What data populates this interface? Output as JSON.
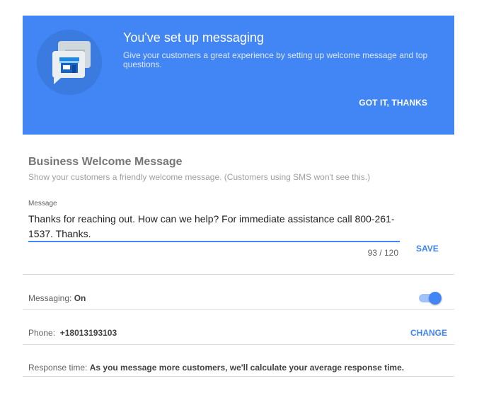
{
  "banner": {
    "title": "You've set up messaging",
    "description": "Give your customers a great experience by setting up welcome message and top questions.",
    "action_label": "GOT IT, THANKS",
    "background_color": "#4285f4",
    "icon": "storefront-chat-icon"
  },
  "welcome": {
    "title": "Business Welcome Message",
    "subtitle": "Show your customers a friendly welcome message. (Customers using SMS won't see this.)",
    "field_label": "Message",
    "message_value": "Thanks for reaching out. How can we help? For immediate assistance call 800-261-1537. Thanks.",
    "char_count": "93 / 120",
    "save_label": "SAVE"
  },
  "settings": {
    "messaging": {
      "label": "Messaging: ",
      "value": "On",
      "enabled": true
    },
    "phone": {
      "label": "Phone:",
      "value": "+18013193103",
      "change_label": "CHANGE"
    },
    "response_time": {
      "label": "Response time: ",
      "value": "As you message more customers, we'll calculate your average response time."
    }
  },
  "accent_color": "#4285f4"
}
